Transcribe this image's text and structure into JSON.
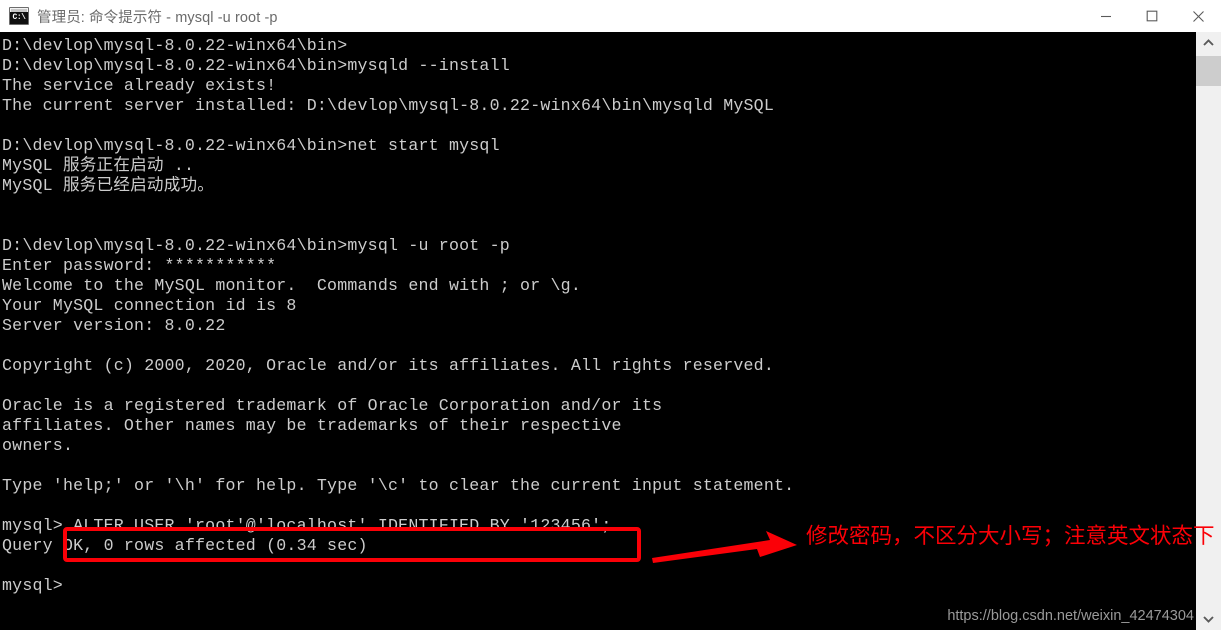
{
  "window": {
    "title": "管理员: 命令提示符 - mysql  -u root -p",
    "icon_name": "console-icon",
    "icon_glyph": "C:\\",
    "controls": {
      "minimize_label": "最小化",
      "maximize_label": "最大化",
      "close_label": "关闭"
    }
  },
  "console": {
    "background_color": "#000000",
    "text_color": "#cccccc",
    "lines": [
      "D:\\devlop\\mysql-8.0.22-winx64\\bin>",
      "D:\\devlop\\mysql-8.0.22-winx64\\bin>mysqld --install",
      "The service already exists!",
      "The current server installed: D:\\devlop\\mysql-8.0.22-winx64\\bin\\mysqld MySQL",
      "",
      "D:\\devlop\\mysql-8.0.22-winx64\\bin>net start mysql",
      "MySQL 服务正在启动 ..",
      "MySQL 服务已经启动成功。",
      "",
      "",
      "D:\\devlop\\mysql-8.0.22-winx64\\bin>mysql -u root -p",
      "Enter password: ***********",
      "Welcome to the MySQL monitor.  Commands end with ; or \\g.",
      "Your MySQL connection id is 8",
      "Server version: 8.0.22",
      "",
      "Copyright (c) 2000, 2020, Oracle and/or its affiliates. All rights reserved.",
      "",
      "Oracle is a registered trademark of Oracle Corporation and/or its",
      "affiliates. Other names may be trademarks of their respective",
      "owners.",
      "",
      "Type 'help;' or '\\h' for help. Type '\\c' to clear the current input statement.",
      "",
      "mysql> ALTER USER 'root'@'localhost' IDENTIFIED BY '123456';",
      "Query OK, 0 rows affected (0.34 sec)",
      "",
      "mysql>"
    ]
  },
  "scrollbar": {
    "up_arrow_name": "scroll-up-arrow",
    "down_arrow_name": "scroll-down-arrow",
    "thumb_name": "scroll-thumb"
  },
  "annotation": {
    "color": "#fb0007",
    "note_text": "修改密码，不区分大小写；注意英文状态下",
    "highlighted_command": "ALTER USER 'root'@'localhost' IDENTIFIED BY '123456';"
  },
  "watermark": {
    "text": "https://blog.csdn.net/weixin_42474304"
  }
}
